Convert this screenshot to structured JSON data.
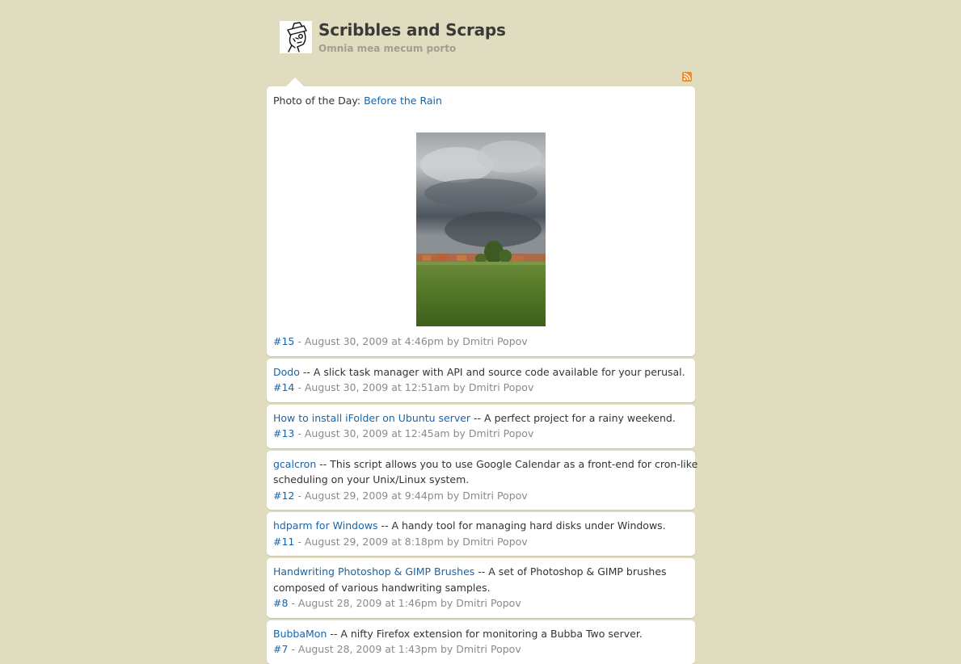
{
  "site": {
    "title": "Scribbles and Scraps",
    "tagline": "Omnia mea mecum porto",
    "rss_icon": "rss-feed-icon"
  },
  "featured": {
    "prefix": "Photo of the Day: ",
    "link": "Before the Rain",
    "permalink": "#15",
    "meta": " - August 30, 2009 at 4:46pm by Dmitri Popov"
  },
  "posts": [
    {
      "link": "Dodo",
      "desc": " -- A slick task manager with API and source code available for your perusal.",
      "permalink": "#14",
      "meta": " - August 30, 2009 at 12:51am by Dmitri Popov"
    },
    {
      "link": "How to install iFolder on Ubuntu server",
      "desc": " -- A perfect project for a rainy weekend.",
      "permalink": "#13",
      "meta": " - August 30, 2009 at 12:45am by Dmitri Popov"
    },
    {
      "link": "gcalcron",
      "desc": " -- This script allows you to use Google Calendar as a front-end for cron-like",
      "desc2": "scheduling on your Unix/Linux system.",
      "permalink": "#12",
      "meta": " - August 29, 2009 at 9:44pm by Dmitri Popov"
    },
    {
      "link": "hdparm for Windows",
      "desc": " -- A handy tool for managing hard disks under Windows.",
      "permalink": "#11",
      "meta": " - August 29, 2009 at 8:18pm by Dmitri Popov"
    },
    {
      "link": "Handwriting Photoshop & GIMP Brushes",
      "desc": " -- A set of Photoshop & GIMP brushes",
      "desc2": "composed of various handwriting samples.",
      "permalink": "#8",
      "meta": " - August 28, 2009 at 1:46pm by Dmitri Popov"
    },
    {
      "link": "BubbaMon",
      "desc": " -- A nifty Firefox extension for monitoring a Bubba Two server.",
      "permalink": "#7",
      "meta": " - August 28, 2009 at 1:43pm by Dmitri Popov"
    }
  ]
}
